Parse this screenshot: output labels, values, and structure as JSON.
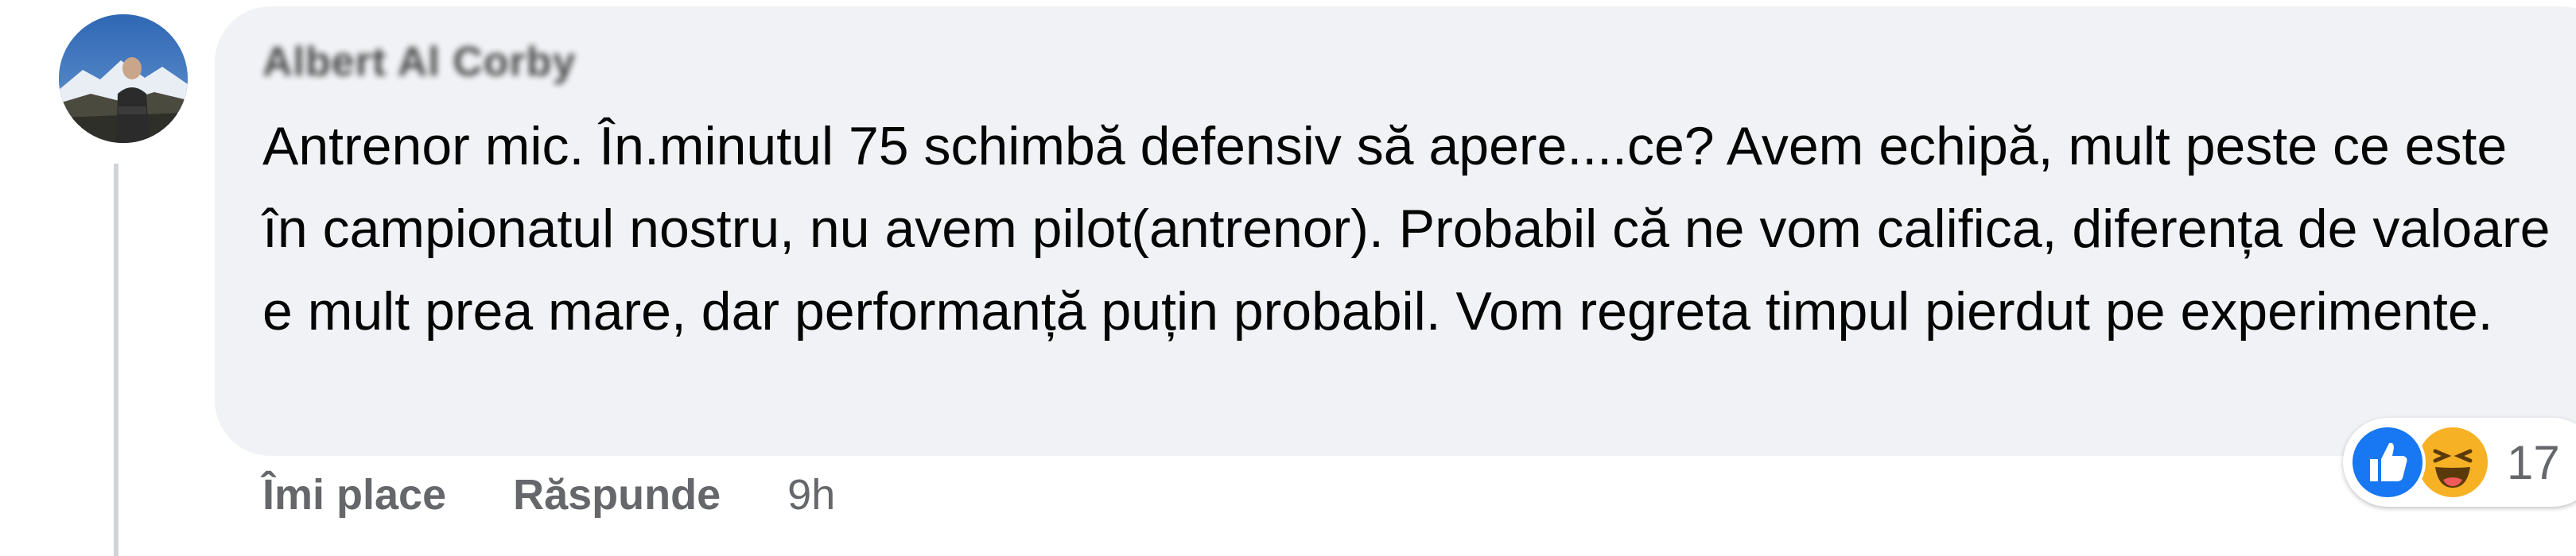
{
  "comment": {
    "author_name": "Albert Al Corby",
    "text": "Antrenor mic. În.minutul 75 schimbă defensiv să apere....ce? Avem echipă, mult peste ce este în campionatul nostru, nu avem pilot(antrenor). Probabil că ne vom califica, diferența de valoare e mult prea mare, dar performanță puțin probabil. Vom regreta timpul pierdut pe experimente.",
    "actions": {
      "like_label": "Îmi place",
      "reply_label": "Răspunde",
      "timestamp": "9h"
    },
    "reactions": {
      "icons": [
        "like-icon",
        "haha-icon"
      ],
      "count": "17"
    }
  },
  "colors": {
    "bubble_bg": "#f0f2f5",
    "like_blue": "#1877f2",
    "haha_yellow": "#f7b125",
    "secondary_text": "#65676b"
  }
}
